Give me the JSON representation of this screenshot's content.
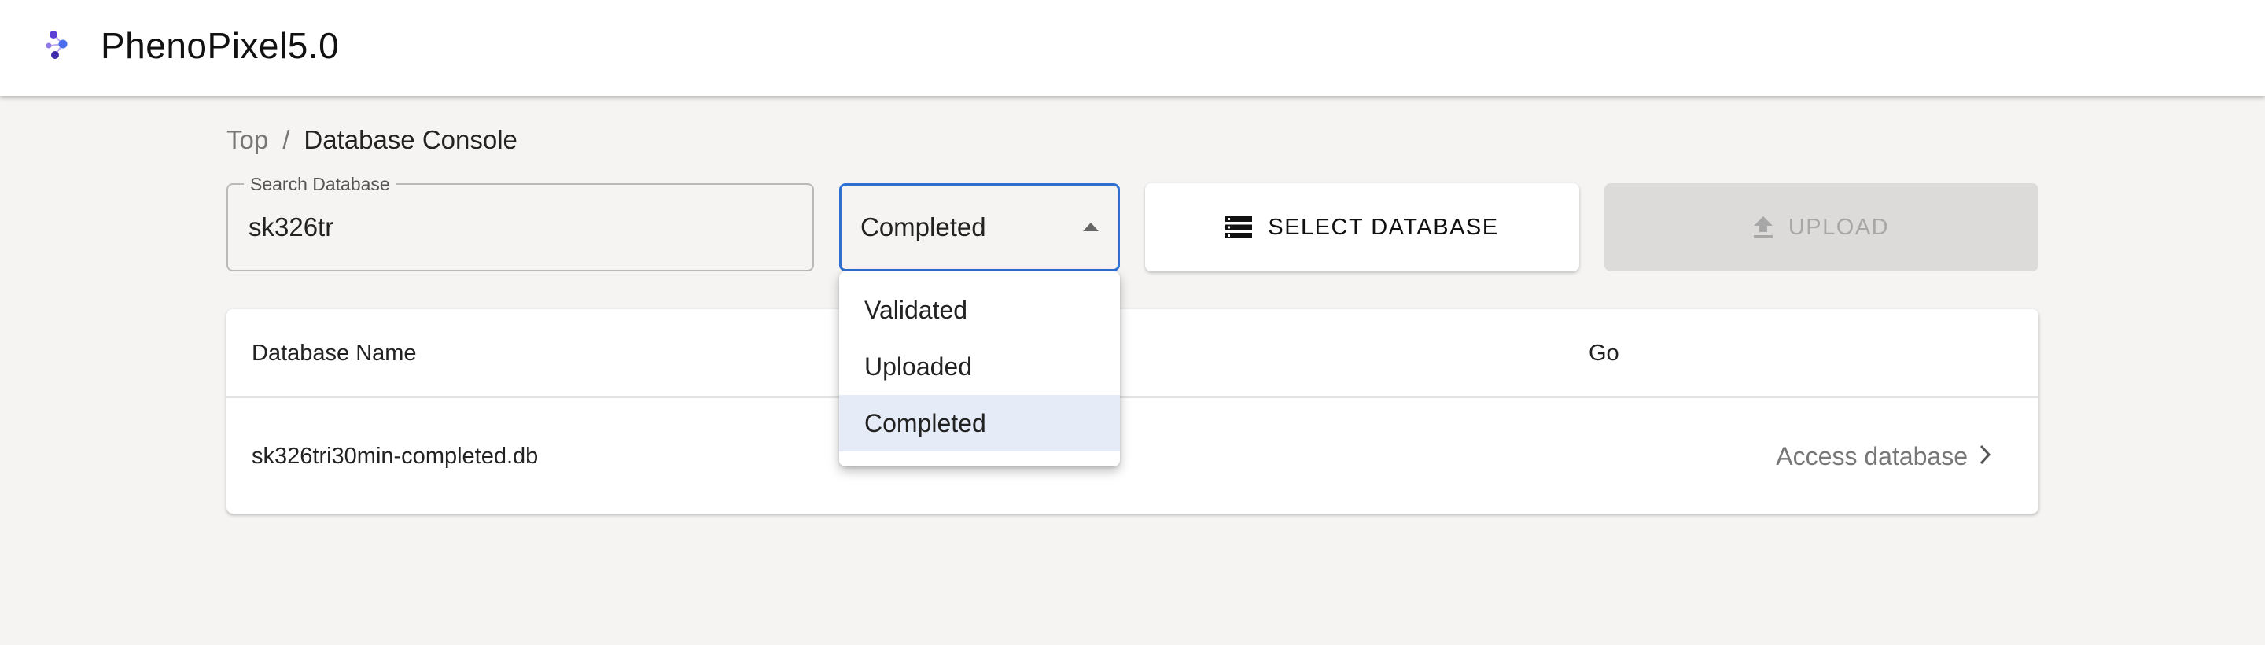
{
  "app": {
    "title": "PhenoPixel5.0",
    "accent_color": "#5b3fd6"
  },
  "breadcrumb": {
    "items": [
      "Top",
      "Database Console"
    ],
    "separator": "/"
  },
  "search": {
    "label": "Search Database",
    "value": "sk326tr"
  },
  "status_select": {
    "selected": "Completed",
    "options": [
      "Validated",
      "Uploaded",
      "Completed"
    ],
    "open": true
  },
  "toolbar": {
    "select_database_label": "SELECT DATABASE",
    "upload_label": "UPLOAD",
    "upload_disabled": true
  },
  "table": {
    "columns": [
      "Database Name",
      "Go"
    ],
    "rows": [
      {
        "name": "sk326tri30min-completed.db",
        "action": "Access database"
      }
    ]
  },
  "icons": {
    "logo": "pheno-logo-icon",
    "select_database": "storage-icon",
    "upload": "upload-icon",
    "dropdown": "caret-up-icon",
    "access": "chevron-right-icon"
  }
}
